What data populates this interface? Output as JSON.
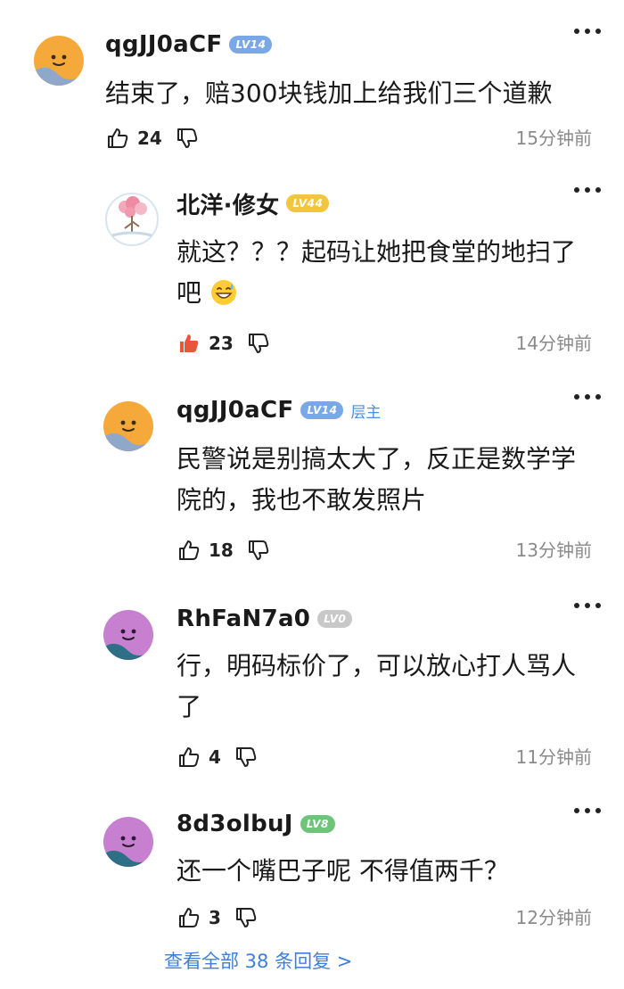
{
  "comments": [
    {
      "username": "qgJJ0aCF",
      "level": "LV14",
      "level_color": "#7aa7e6",
      "op_tag": "",
      "lines": [
        "结束了，赔300块钱加上给我们三个道歉"
      ],
      "likes": "24",
      "liked": false,
      "time": "15分钟前",
      "avatar": "smiley-orange"
    },
    {
      "username": "北洋·修女",
      "level": "LV44",
      "level_color": "#f0c63c",
      "op_tag": "",
      "lines": [
        "就这？？？起码让她把食堂的地扫了",
        "吧"
      ],
      "emoji": "sweat-smile-emoji",
      "likes": "23",
      "liked": true,
      "time": "14分钟前",
      "avatar": "cherry-blossom"
    },
    {
      "username": "qgJJ0aCF",
      "level": "LV14",
      "level_color": "#7aa7e6",
      "op_tag": "层主",
      "lines": [
        "民警说是别搞太大了，反正是数学学",
        "院的，我也不敢发照片"
      ],
      "likes": "18",
      "liked": false,
      "time": "13分钟前",
      "avatar": "smiley-orange"
    },
    {
      "username": "RhFaN7a0",
      "level": "LV0",
      "level_color": "#c8c8c8",
      "op_tag": "",
      "lines": [
        "行，明码标价了，可以放心打人骂人",
        "了"
      ],
      "likes": "4",
      "liked": false,
      "time": "11分钟前",
      "avatar": "smiley-purple"
    },
    {
      "username": "8d3olbuJ",
      "level": "LV8",
      "level_color": "#6fc47a",
      "op_tag": "",
      "lines": [
        "还一个嘴巴子呢 不得值两千？"
      ],
      "likes": "3",
      "liked": false,
      "time": "12分钟前",
      "avatar": "smiley-purple"
    }
  ],
  "view_all": "查看全部 38 条回复 >",
  "colors": {
    "link": "#3e7fd8",
    "liked": "#e8553d",
    "muted": "#8a8a8a"
  }
}
